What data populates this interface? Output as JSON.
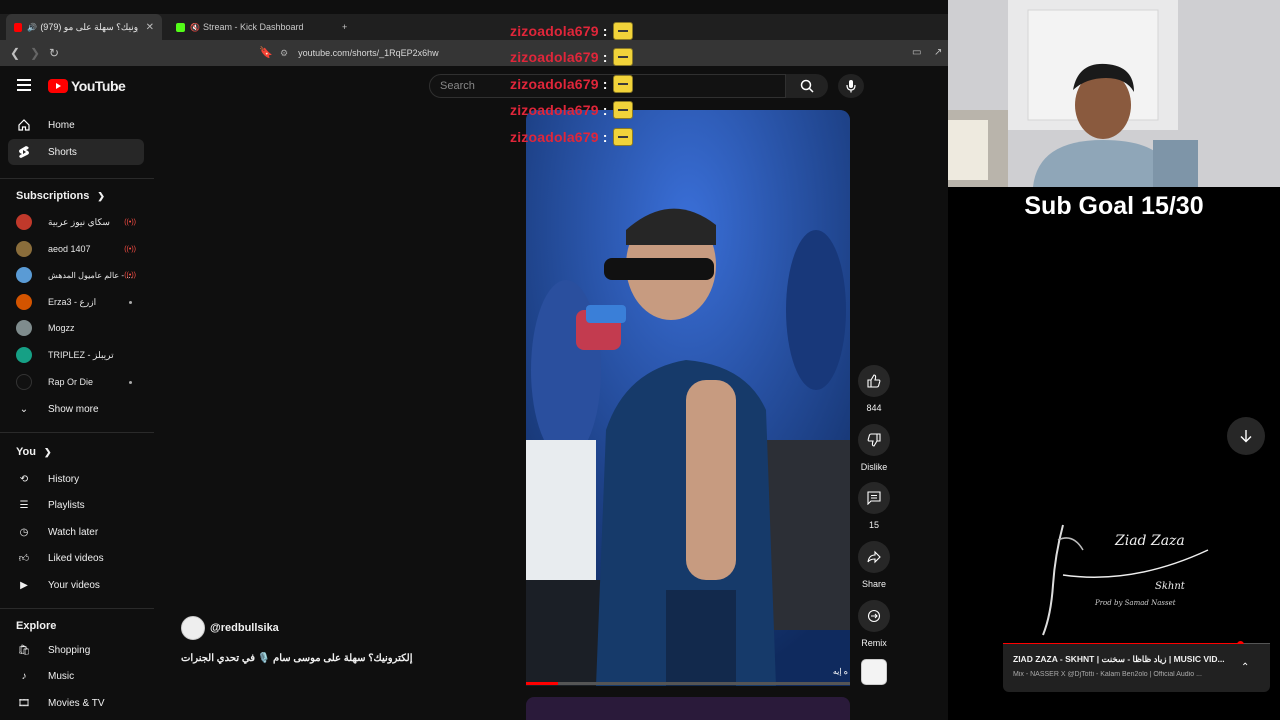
{
  "browser": {
    "tabs": [
      {
        "label": "(979) إلكترونيك؟ سهلة على مو",
        "active": true
      },
      {
        "label": "Stream - Kick Dashboard",
        "active": false
      }
    ],
    "new_tab_label": "+",
    "url": "youtube.com/shorts/_1RqEP2x6hw"
  },
  "header": {
    "logo_text": "YouTube",
    "search_placeholder": "Search"
  },
  "sidebar": {
    "main": [
      {
        "label": "Home",
        "icon": "home-icon"
      },
      {
        "label": "Shorts",
        "icon": "shorts-icon",
        "selected": true
      }
    ],
    "subscriptions_heading": "Subscriptions",
    "subscriptions": [
      {
        "label": "سكاي نيوز عربية",
        "color": "#c0392b",
        "status": "live"
      },
      {
        "label": "aeod 1407",
        "color": "#8a6d3b",
        "status": "live"
      },
      {
        "label": "عالم عاميول المدهش - ...",
        "color": "#5a9bd5",
        "status": "live"
      },
      {
        "label": "Erza3 - ازرع",
        "color": "#d35400",
        "status": "new"
      },
      {
        "label": "Mogzz",
        "color": "#7f8c8d",
        "status": ""
      },
      {
        "label": "TRIPLEZ - تريبلز",
        "color": "#16a085",
        "status": ""
      },
      {
        "label": "Rap Or Die",
        "color": "#111111",
        "status": "new"
      }
    ],
    "show_more": "Show more",
    "you_heading": "You",
    "you_items": [
      {
        "label": "History",
        "icon": "history-icon"
      },
      {
        "label": "Playlists",
        "icon": "playlists-icon"
      },
      {
        "label": "Watch later",
        "icon": "watch-later-icon"
      },
      {
        "label": "Liked videos",
        "icon": "like-icon"
      },
      {
        "label": "Your videos",
        "icon": "your-videos-icon"
      }
    ],
    "explore_heading": "Explore",
    "explore_items": [
      {
        "label": "Shopping",
        "icon": "shopping-icon"
      },
      {
        "label": "Music",
        "icon": "music-icon"
      },
      {
        "label": "Movies & TV",
        "icon": "movies-icon"
      }
    ]
  },
  "chat": [
    {
      "user": "zizoadola679",
      "sep": ":"
    },
    {
      "user": "zizoadola679",
      "sep": ":"
    },
    {
      "user": "zizoadola679",
      "sep": ":"
    },
    {
      "user": "zizoadola679",
      "sep": ":"
    },
    {
      "user": "zizoadola679",
      "sep": ":"
    }
  ],
  "short": {
    "channel": "@redbullsika",
    "title": "إلكترونيك؟ سهلة على موسى سام 🎙️ في تحدي الجنرات",
    "overlay_text": "ه إيه",
    "progress": 0.1,
    "actions": {
      "like_count": "844",
      "dislike_label": "Dislike",
      "comments_count": "15",
      "share_label": "Share",
      "remix_label": "Remix"
    }
  },
  "stream": {
    "sub_goal": "Sub Goal 15/30"
  },
  "music_card": {
    "art_title": "Ziad Zaza",
    "art_subtitle": "Skhnt",
    "art_credit": "Prod by Samad Nasset",
    "title": "ZIAD ZAZA - SKHNT | زياد ظاظا - سخنت | MUSIC VID...",
    "subtitle": "Mix - NASSER X @DjTotti - Kalam Ben2olo | Official Audio ..."
  },
  "colors": {
    "yt_red": "#ff0000",
    "chat_name": "#e0263a",
    "live_red": "#ff4e45"
  }
}
